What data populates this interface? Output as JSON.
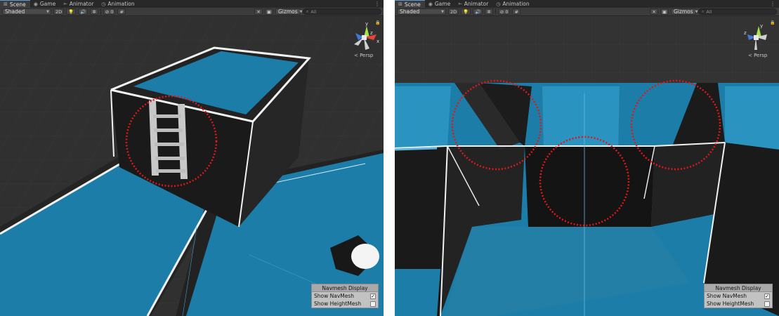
{
  "panels": [
    {
      "id": "left",
      "tabs": [
        {
          "label": "Scene",
          "icon": "grid-icon",
          "glyph": "⊞",
          "active": true
        },
        {
          "label": "Game",
          "icon": "gamepad-icon",
          "glyph": "◉",
          "active": false
        },
        {
          "label": "Animator",
          "icon": "animator-icon",
          "glyph": "⤜",
          "active": false
        },
        {
          "label": "Animation",
          "icon": "animation-clock-icon",
          "glyph": "◷",
          "active": false
        }
      ],
      "toolbar": {
        "shading": "Shaded",
        "mode_2d": "2D",
        "hidden_count": "0",
        "gizmos": "Gizmos",
        "search_placeholder": "All"
      },
      "persp_label": "< Persp",
      "navmesh": {
        "title": "Navmesh Display",
        "rows": [
          {
            "label": "Show NavMesh",
            "checked": true
          },
          {
            "label": "Show HeightMesh",
            "checked": false
          }
        ]
      }
    },
    {
      "id": "right",
      "tabs": [
        {
          "label": "Scene",
          "icon": "grid-icon",
          "glyph": "⊞",
          "active": true
        },
        {
          "label": "Game",
          "icon": "gamepad-icon",
          "glyph": "◉",
          "active": false
        },
        {
          "label": "Animator",
          "icon": "animator-icon",
          "glyph": "⤜",
          "active": false
        },
        {
          "label": "Animation",
          "icon": "animation-clock-icon",
          "glyph": "◷",
          "active": false
        }
      ],
      "toolbar": {
        "shading": "Shaded",
        "mode_2d": "2D",
        "hidden_count": "0",
        "gizmos": "Gizmos",
        "search_placeholder": "All"
      },
      "persp_label": "< Persp",
      "navmesh": {
        "title": "Navmesh Display",
        "rows": [
          {
            "label": "Show NavMesh",
            "checked": true
          },
          {
            "label": "Show HeightMesh",
            "checked": false
          }
        ]
      }
    }
  ],
  "gizmo_axes": {
    "y": "y",
    "x": "x",
    "z": "z"
  },
  "colors": {
    "navmesh_blue": "#1c7ea8",
    "navmesh_blue_light": "#2a93bf",
    "ground": "#2f2f2f",
    "wall_dark": "#1e1e1e",
    "highlight_circle": "#e01818",
    "outline_white": "#f2f2f2",
    "tab_active_accent": "#5a9ad7"
  },
  "icons": {
    "menu": "kebab-menu-icon",
    "lightbulb": "lightbulb-icon",
    "audio": "speaker-icon",
    "effects": "effects-icon",
    "hidden": "eye-slash-icon",
    "grid": "grid-toggle-icon",
    "tools": "tools-icon",
    "camera": "camera-icon",
    "search": "search-icon",
    "lock": "lock-icon"
  }
}
